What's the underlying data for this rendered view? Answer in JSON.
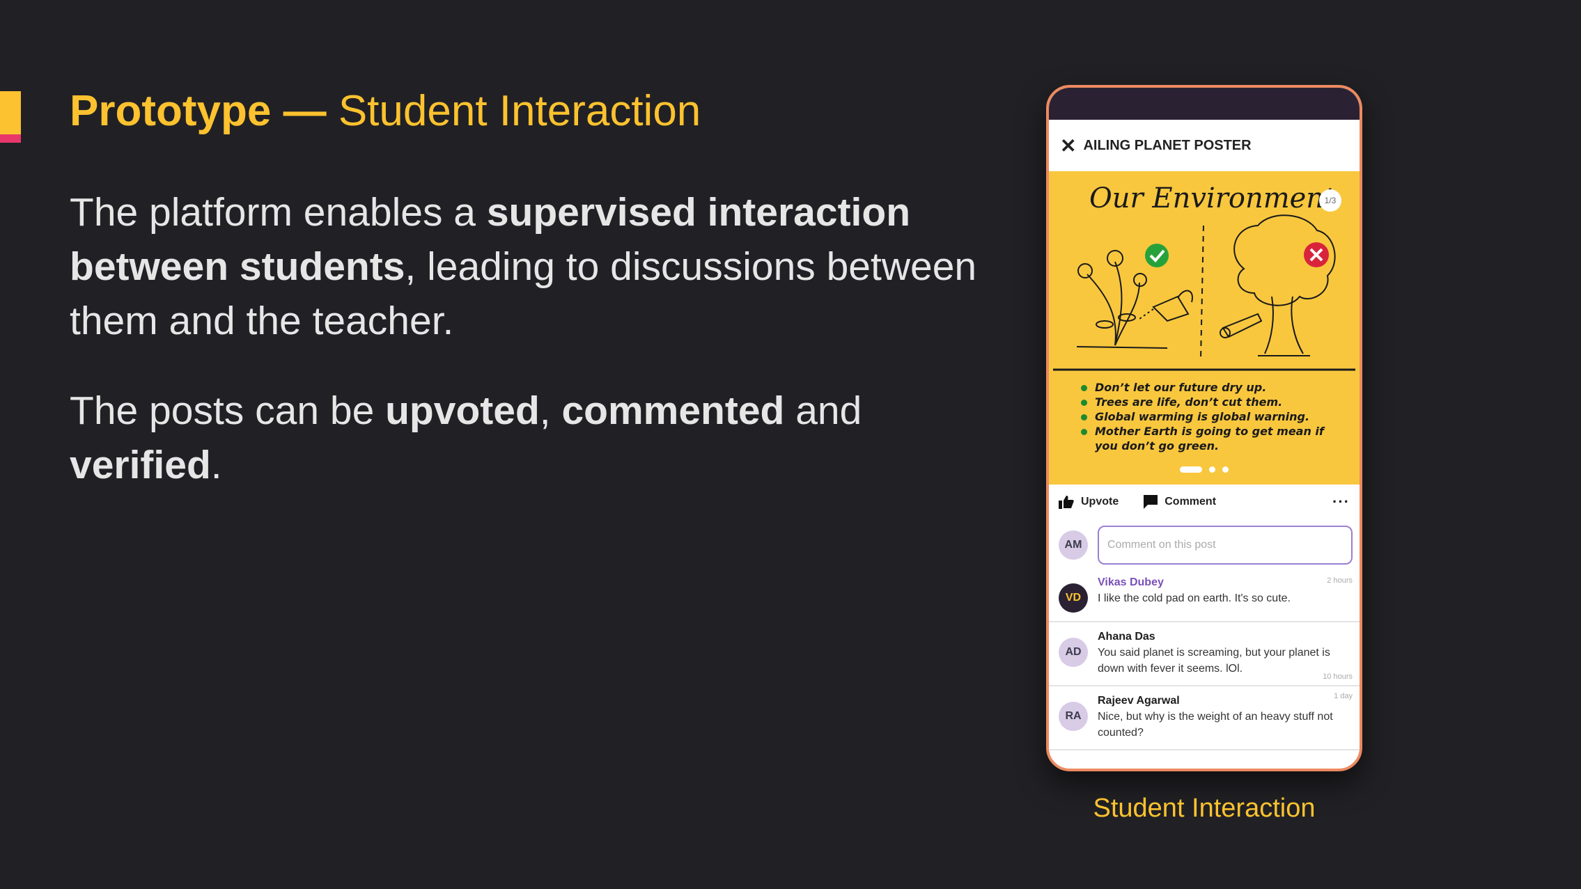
{
  "slide": {
    "title_bold": "Prototype —",
    "title_rest": " Student Interaction",
    "para1": {
      "t1": "The platform enables a ",
      "b1": "supervised interaction between students",
      "t2": ", leading to discussions between them and the teacher."
    },
    "para2": {
      "t1": "The posts can be ",
      "b1": "upvoted",
      "t2": ", ",
      "b2": "commented",
      "t3": " and ",
      "b3": "verified",
      "t4": "."
    },
    "caption": "Student Interaction"
  },
  "phone": {
    "post_title": "AILING PLANET POSTER",
    "poster": {
      "heading": "Our Environment",
      "page_indicator": "1/3",
      "bullets": [
        "Don’t let our future dry up.",
        "Trees are life, don’t cut them.",
        "Global warming is global warning.",
        "Mother Earth is going to get mean if you don’t go green."
      ]
    },
    "actions": {
      "upvote": "Upvote",
      "comment": "Comment",
      "more": "···"
    },
    "comment_box": {
      "avatar": "AM",
      "placeholder": "Comment on this post"
    },
    "comments": [
      {
        "initials": "VD",
        "name": "Vikas Dubey",
        "text": "I like the cold pad on earth. It's so cute.",
        "time": "2 hours"
      },
      {
        "initials": "AD",
        "name": "Ahana Das",
        "text": "You said planet is screaming, but your planet is down with fever it seems. lOl.",
        "time": "10 hours"
      },
      {
        "initials": "RA",
        "name": "Rajeev Agarwal",
        "text": "Nice, but why is the weight of an heavy stuff not counted?",
        "time": "1 day"
      }
    ]
  },
  "colors": {
    "background": "#212125",
    "accent_yellow": "#fcc22f",
    "accent_pink": "#e8386b",
    "phone_border": "#ec8a60",
    "poster_yellow": "#f8c73e",
    "username_purple": "#7a50b8",
    "verified_green": "#27a23a",
    "reject_red": "#d9233a"
  }
}
